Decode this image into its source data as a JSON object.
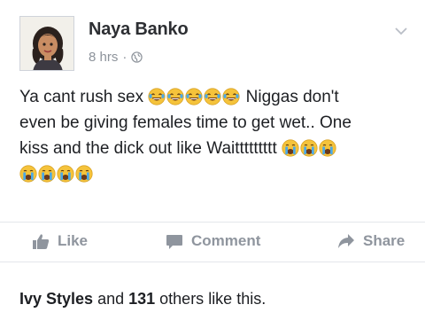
{
  "post": {
    "author": "Naya Banko",
    "time": "8 hrs",
    "separator": "·",
    "privacy_icon": "globe-icon",
    "text_line1_a": "Ya cant rush sex ",
    "text_line1_b": " Niggas don't",
    "text_line2": "even be giving females time to get wet.. One",
    "text_line3": "kiss and the dick out like Waittttttttt ",
    "laughing_emoji_count": 5,
    "crying_emoji_count": 7
  },
  "actions": {
    "like_label": "Like",
    "comment_label": "Comment",
    "share_label": "Share"
  },
  "likes": {
    "first_liker": "Ivy Styles",
    "and_text": " and ",
    "count": "131",
    "others_text": " others",
    "suffix": " like this."
  },
  "colors": {
    "text": "#1d1f23",
    "secondary": "#8f959e",
    "emoji_yellow": "#f5c33b",
    "tear_blue": "#4aa8e8"
  }
}
